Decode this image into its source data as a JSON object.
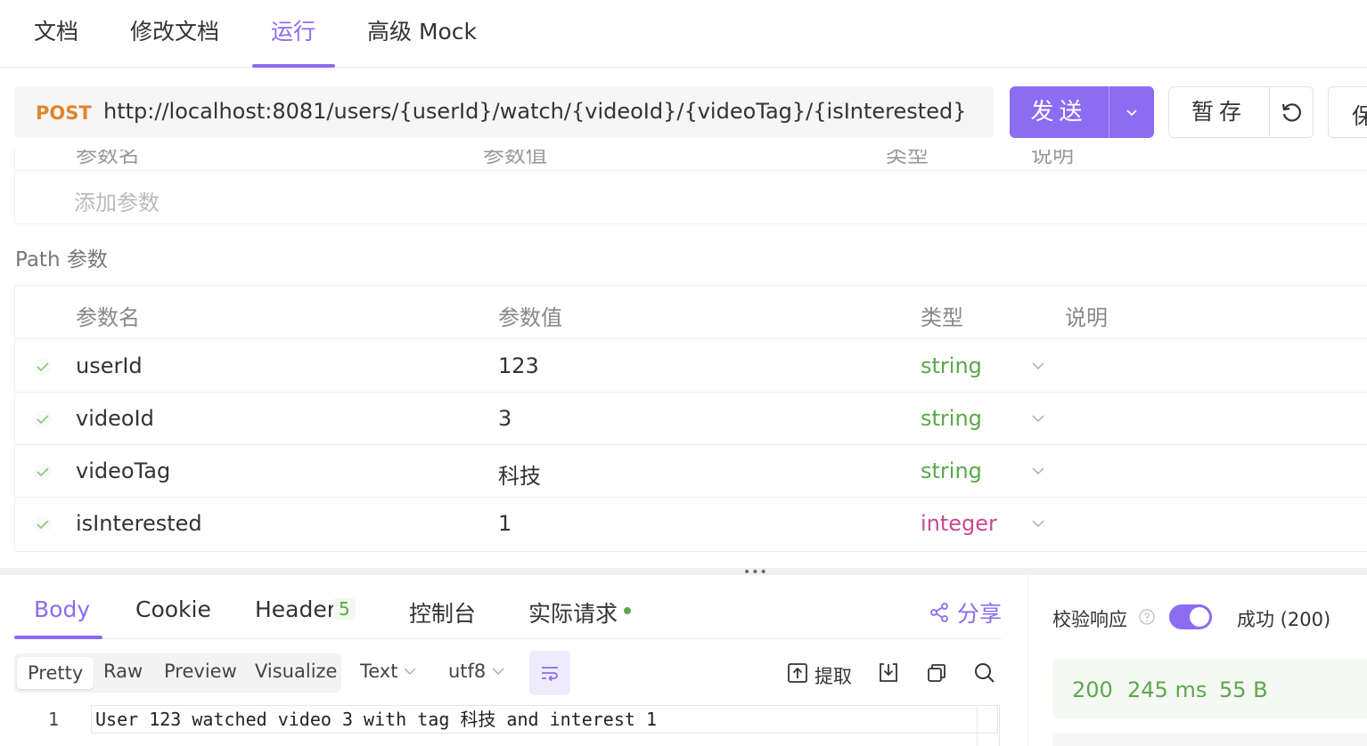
{
  "top_tabs": [
    {
      "label": "文档"
    },
    {
      "label": "修改文档"
    },
    {
      "label": "运行"
    },
    {
      "label": "高级 Mock"
    }
  ],
  "request": {
    "method": "POST",
    "url": "http://localhost:8081/users/{userId}/watch/{videoId}/{videoTag}/{isInterested}",
    "send_label": "发送",
    "save_label": "暂存",
    "keep_label": "保"
  },
  "query": {
    "headers": [
      "参数名",
      "参数值",
      "类型",
      "说明"
    ],
    "add_placeholder": "添加参数"
  },
  "path": {
    "title": "Path 参数",
    "headers": [
      "参数名",
      "参数值",
      "类型",
      "说明"
    ],
    "rows": [
      {
        "name": "userId",
        "value": "123",
        "type": "string"
      },
      {
        "name": "videoId",
        "value": "3",
        "type": "string"
      },
      {
        "name": "videoTag",
        "value": "科技",
        "type": "string"
      },
      {
        "name": "isInterested",
        "value": "1",
        "type": "integer"
      }
    ]
  },
  "response": {
    "tabs": [
      "Body",
      "Cookie",
      "Header",
      "控制台",
      "实际请求"
    ],
    "header_count": "5",
    "share_label": "分享",
    "views": [
      "Pretty",
      "Raw",
      "Preview",
      "Visualize"
    ],
    "format": "Text",
    "encoding": "utf8",
    "extract_label": "提取",
    "code_line_no": "1",
    "code_text": "User 123 watched video 3 with tag 科技 and interest 1"
  },
  "validation": {
    "label": "校验响应",
    "toggle_on": true,
    "result": "成功 (200)",
    "status": "200",
    "time": "245 ms",
    "size": "55 B"
  },
  "colors": {
    "accent": "#8a6cf0",
    "post": "#e0852a",
    "string": "#5aa84a",
    "integer": "#c84a8e"
  }
}
